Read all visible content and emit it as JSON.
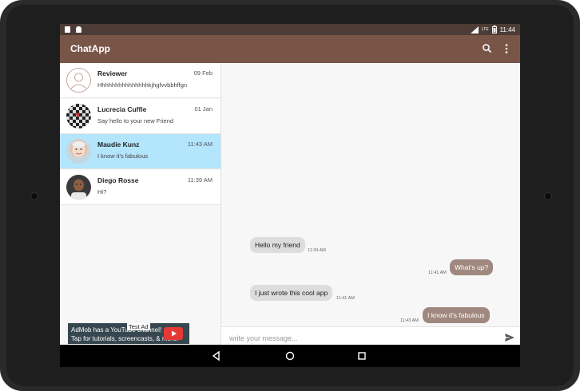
{
  "status_bar": {
    "time": "11:44",
    "network": "LTE"
  },
  "app_bar": {
    "title": "ChatApp",
    "icons": [
      "search-icon",
      "more-vert-icon"
    ]
  },
  "chats": [
    {
      "name": "Reviewer",
      "time": "09 Feb",
      "preview": "Hhhhhhhhhhhhhhhkjhgfvvbbhffgn",
      "avatar": "default-person-avatar",
      "active": false
    },
    {
      "name": "Lucrecia Cuffie",
      "time": "01 Jan",
      "preview": "Say hello to your new Friend",
      "avatar": "checkered-avatar",
      "active": false
    },
    {
      "name": "Maudie Kunz",
      "time": "11:43 AM",
      "preview": "I know it's fabulous",
      "avatar": "photo-avatar",
      "active": true
    },
    {
      "name": "Diego Rosse",
      "time": "11:39 AM",
      "preview": "Hi?",
      "avatar": "photo-avatar",
      "active": false
    }
  ],
  "ad": {
    "line1": "AdMob has a YouTube channel!",
    "line2": "Tap for tutorials, screencasts, & more.",
    "badge": "Test Ad"
  },
  "messages": [
    {
      "text": "Hello my friend",
      "time": "11:34 AM",
      "direction": "incoming"
    },
    {
      "text": "What's up?",
      "time": "11:41 AM",
      "direction": "outgoing"
    },
    {
      "text": "I just wrote this cool app",
      "time": "11:41 AM",
      "direction": "incoming"
    },
    {
      "text": "I know it's fabulous",
      "time": "11:43 AM",
      "direction": "outgoing"
    }
  ],
  "composer": {
    "placeholder": "write your message..."
  },
  "colors": {
    "primary": "#795548",
    "primary_dark": "#4d3c35",
    "accent_bubble": "#a1887f",
    "selected": "#b3e5fc"
  },
  "nav_buttons": [
    "back-icon",
    "home-icon",
    "recents-icon"
  ]
}
